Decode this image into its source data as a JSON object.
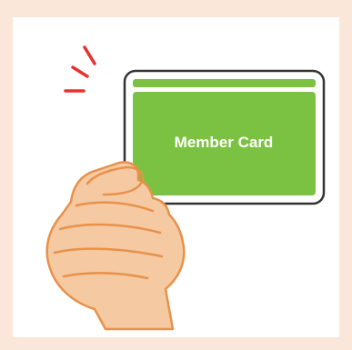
{
  "card": {
    "label": "Member Card",
    "color": "#7cc242",
    "border_color": "#333333"
  },
  "hand": {
    "skin_color": "#f5c9a2",
    "outline_color": "#e8914a"
  },
  "motion_marks": {
    "color": "#e8312f",
    "count": 3
  },
  "background": {
    "outer": "#fbe6da",
    "inner": "#ffffff"
  }
}
